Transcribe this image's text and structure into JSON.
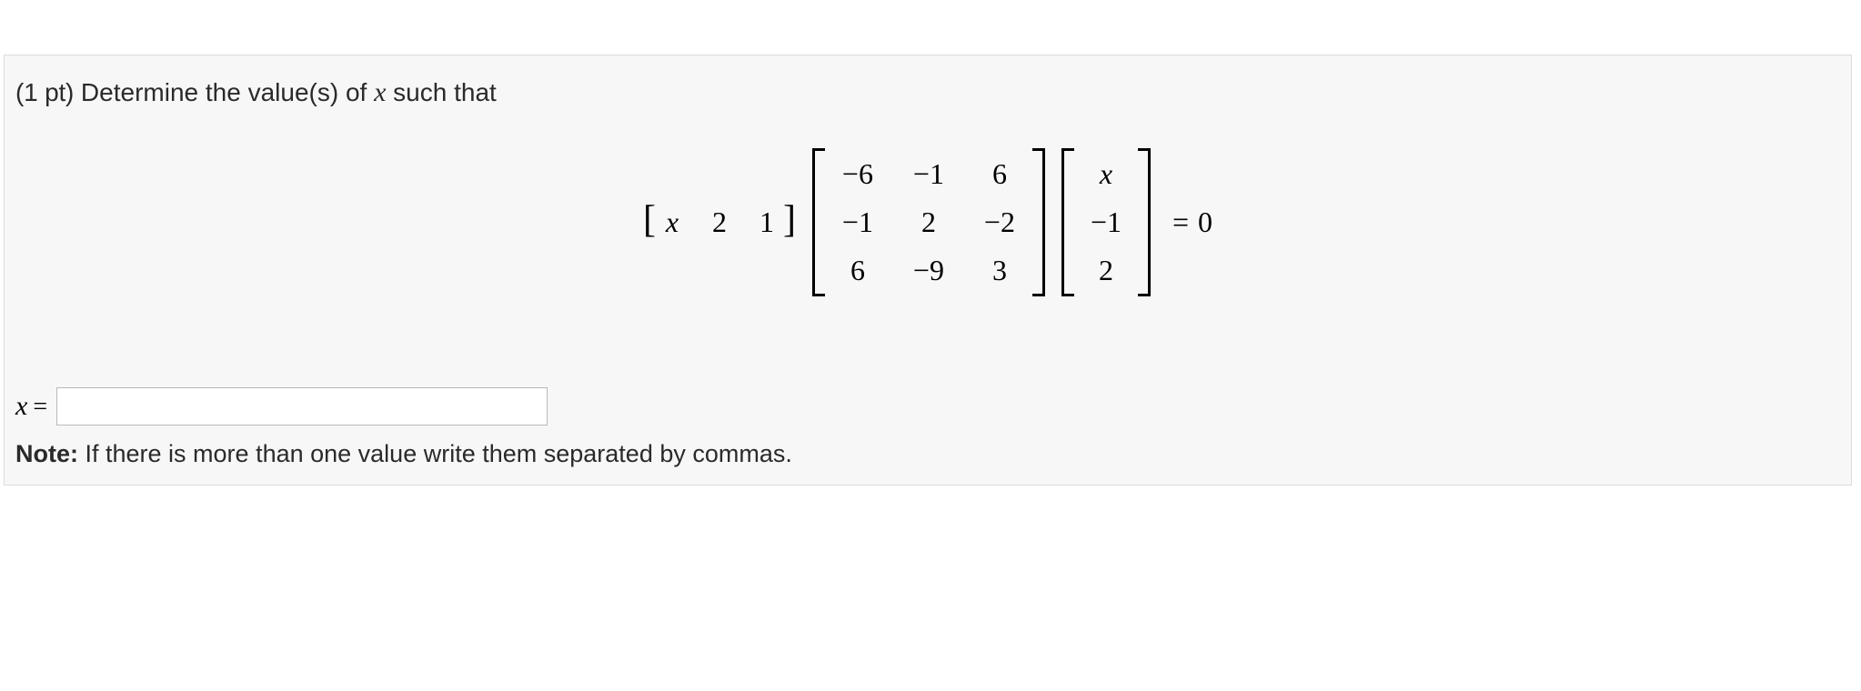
{
  "problem": {
    "points_prefix": "(1 pt)",
    "prompt_before_var": " Determine the value(s) of ",
    "variable": "x",
    "prompt_after_var": " such that"
  },
  "equation": {
    "row_vector": [
      "x",
      "2",
      "1"
    ],
    "matrix": [
      [
        "−6",
        "−1",
        "6"
      ],
      [
        "−1",
        "2",
        "−2"
      ],
      [
        "6",
        "−9",
        "3"
      ]
    ],
    "col_vector": [
      "x",
      "−1",
      "2"
    ],
    "equals": "=",
    "rhs": "0"
  },
  "answer": {
    "label_var": "x",
    "label_eq": "=",
    "value": ""
  },
  "note": {
    "bold": "Note:",
    "text": " If there is more than one value write them separated by commas."
  }
}
